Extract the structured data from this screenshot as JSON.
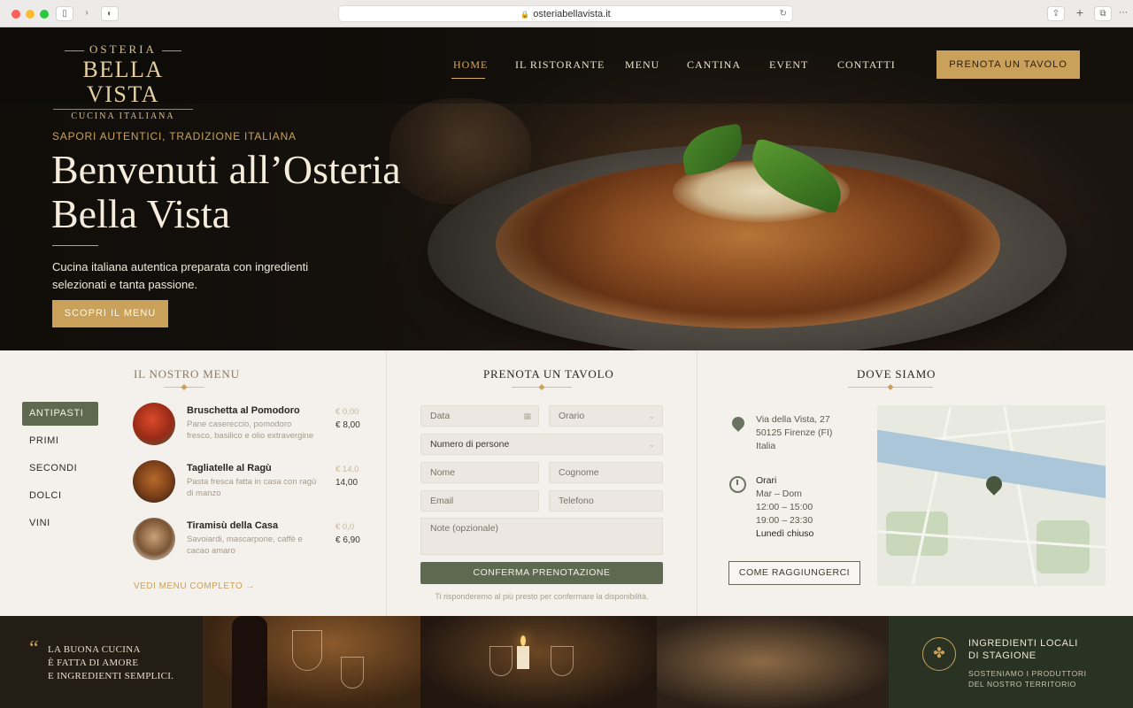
{
  "browser": {
    "url": "osteriabellavista.it"
  },
  "logo": {
    "line1": "OSTERIA",
    "line2": "BELLA VISTA",
    "line3": "CUCINA ITALIANA"
  },
  "nav": {
    "items": [
      "HOME",
      "IL RISTORANTE",
      "MENU",
      "CANTINA",
      "EVENT",
      "CONTATTI"
    ],
    "active": "HOME",
    "cta": "PRENOTA UN TAVOLO"
  },
  "hero": {
    "eyebrow": "SAPORI AUTENTICI, TRADIZIONE ITALIANA",
    "title": "Benvenuti all’Osteria Bella Vista",
    "lead": "Cucina italiana autentica preparata con ingredienti selezionati e tanta passione.",
    "cta": "SCOPRI IL MENU"
  },
  "menu": {
    "title": "IL NOSTRO MENU",
    "categories": [
      "ANTIPASTI",
      "PRIMI",
      "SECONDI",
      "DOLCI",
      "VINI"
    ],
    "active_category": "ANTIPASTI",
    "dishes": [
      {
        "name": "Bruschetta al Pomodoro",
        "desc": "Pane casereccio, pomodoro fresco, basilico e olio extravergine",
        "price_faded": "€ 0,00",
        "price": "€ 8,00"
      },
      {
        "name": "Tagliatelle al Ragù",
        "desc": "Pasta fresca fatta in casa con ragù di manzo",
        "price_faded": "€ 14,0",
        "price": "14,00"
      },
      {
        "name": "Tiramisù della Casa",
        "desc": "Savoiardi, mascarpone, caffè e cacao amaro",
        "price_faded": "€ 0,0",
        "price": "€ 6,90"
      }
    ],
    "more_link": "VEDI MENU COMPLETO →"
  },
  "booking": {
    "title": "PRENOTA UN TAVOLO",
    "fields": {
      "date": "Data",
      "time": "Orario",
      "people": "Numero di persone",
      "first_name": "Nome",
      "last_name": "Cognome",
      "email": "Email",
      "phone": "Telefono",
      "notes": "Note (opzionale)"
    },
    "submit": "CONFERMA PRENOTAZIONE",
    "note": "Ti risponderemo al più presto per confermare la disponibilità."
  },
  "location": {
    "title": "DOVE SIAMO",
    "address": [
      "Via della Vista, 27",
      "50125 Firenze (FI)",
      "Italia"
    ],
    "hours_title": "Orari",
    "hours": [
      "Mar – Dom",
      "12:00 – 15:00",
      "19:00 – 23:30"
    ],
    "closed": "Lunedì chiuso",
    "directions": "COME RAGGIUNGERCI"
  },
  "bottom": {
    "quote_mark": "“",
    "quote": [
      "LA BUONA CUCINA",
      "È FATTA DI AMORE",
      "E INGREDIENTI SEMPLICI."
    ],
    "local_title": [
      "INGREDIENTI LOCALI",
      "DI STAGIONE"
    ],
    "local_sub": [
      "SOSTENIAMO I PRODUTTORI",
      "DEL NOSTRO TERRITORIO"
    ]
  },
  "colors": {
    "gold": "#c9a15a",
    "olive": "#5e6a4f",
    "cream": "#f4f1ec"
  }
}
